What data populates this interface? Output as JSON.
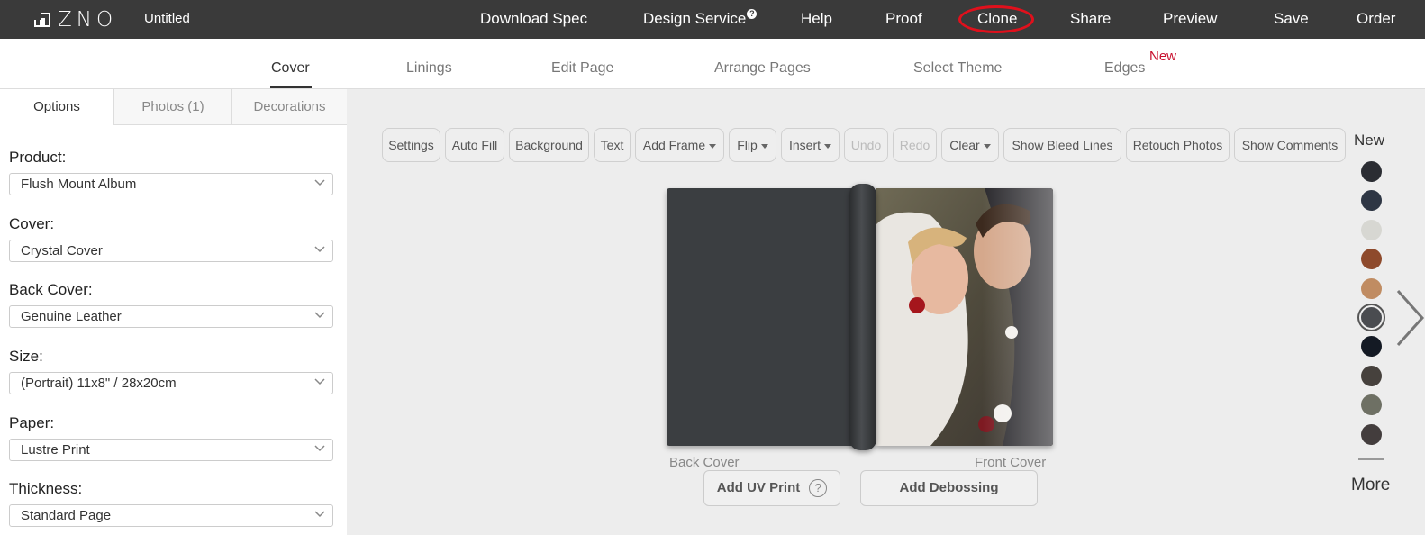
{
  "header": {
    "logo_text": "ZNO",
    "doc_title": "Untitled",
    "nav": [
      {
        "label": "Download Spec"
      },
      {
        "label": "Design Service",
        "badge": "?"
      },
      {
        "label": "Help"
      },
      {
        "label": "Proof"
      },
      {
        "label": "Clone"
      },
      {
        "label": "Share"
      },
      {
        "label": "Preview"
      },
      {
        "label": "Save"
      },
      {
        "label": "Order"
      }
    ]
  },
  "tabs": {
    "items": [
      {
        "label": "Cover",
        "active": true
      },
      {
        "label": "Linings"
      },
      {
        "label": "Edit Page"
      },
      {
        "label": "Arrange Pages"
      },
      {
        "label": "Select Theme"
      },
      {
        "label": "Edges"
      }
    ],
    "new_badge": "New"
  },
  "sidebar": {
    "tabs": [
      {
        "label": "Options",
        "active": true
      },
      {
        "label": "Photos (1)"
      },
      {
        "label": "Decorations"
      }
    ],
    "fields": [
      {
        "label": "Product:",
        "value": "Flush Mount Album"
      },
      {
        "label": "Cover:",
        "value": "Crystal Cover"
      },
      {
        "label": "Back Cover:",
        "value": "Genuine Leather"
      },
      {
        "label": "Size:",
        "value": "(Portrait) 11x8\" / 28x20cm"
      },
      {
        "label": "Paper:",
        "value": "Lustre Print"
      },
      {
        "label": "Thickness:",
        "value": "Standard Page"
      }
    ]
  },
  "toolbar": {
    "buttons": [
      {
        "label": "Settings"
      },
      {
        "label": "Auto Fill"
      },
      {
        "label": "Background"
      },
      {
        "label": "Text"
      },
      {
        "label": "Add Frame",
        "dropdown": true
      },
      {
        "label": "Flip",
        "dropdown": true
      },
      {
        "label": "Insert",
        "dropdown": true
      },
      {
        "label": "Undo",
        "disabled": true
      },
      {
        "label": "Redo",
        "disabled": true
      },
      {
        "label": "Clear",
        "dropdown": true
      },
      {
        "label": "Show Bleed Lines"
      },
      {
        "label": "Retouch Photos"
      },
      {
        "label": "Show Comments"
      }
    ]
  },
  "canvas": {
    "back_label": "Back Cover",
    "front_label": "Front Cover",
    "uv_button": "Add UV Print",
    "uv_help": "?",
    "deboss_button": "Add Debossing"
  },
  "swatches": {
    "title": "New",
    "colors": [
      "#2b2d33",
      "#2e3644",
      "#d7d7d2",
      "#8e4a2c",
      "#c08c62",
      "#4a4c50",
      "#141a24",
      "#46413d",
      "#6e7064",
      "#433d3d"
    ],
    "selected_index": 5,
    "more_label": "More"
  },
  "annotation": {
    "circled_item": "Clone",
    "color": "#e0101c"
  }
}
